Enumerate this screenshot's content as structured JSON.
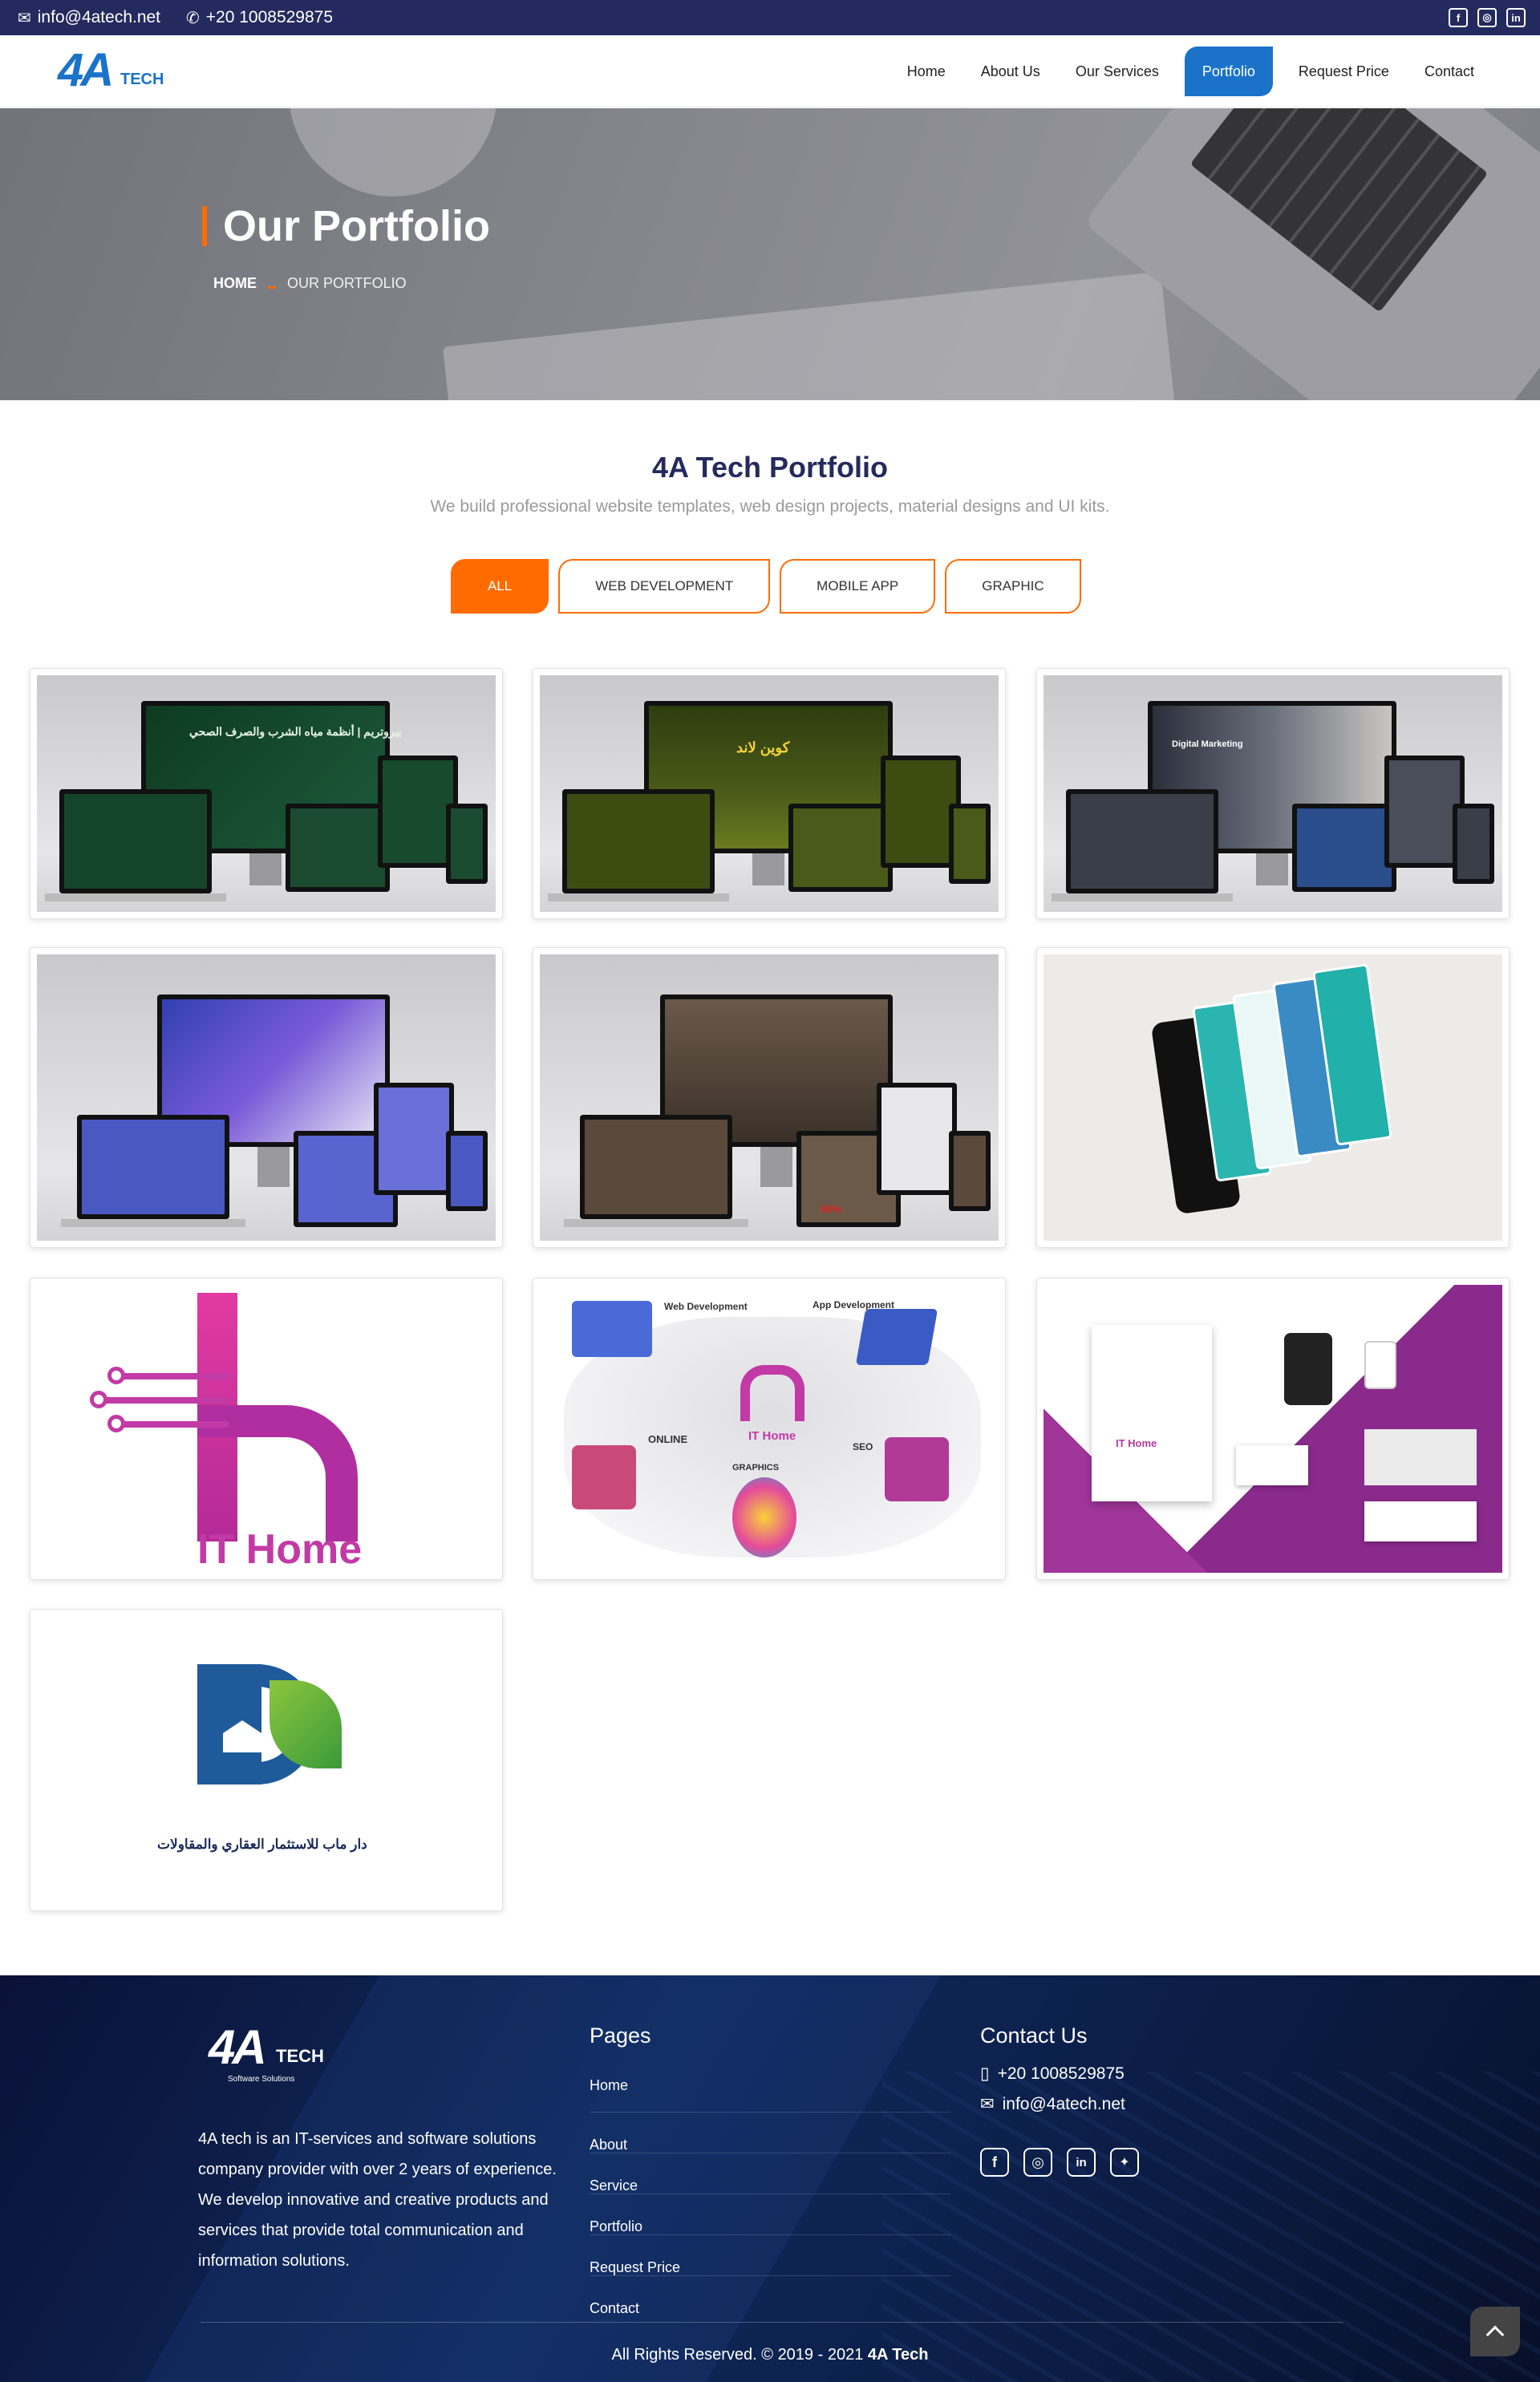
{
  "topbar": {
    "email": "info@4atech.net",
    "phone": "+20 1008529875",
    "social_icons": [
      "facebook-icon",
      "instagram-icon",
      "linkedin-icon"
    ]
  },
  "header": {
    "logo_text": "4A",
    "logo_sub": "TECH",
    "nav": [
      "Home",
      "About Us",
      "Our Services",
      "Portfolio",
      "Request Price",
      "Contact"
    ],
    "active_nav": "Portfolio"
  },
  "hero": {
    "title": "Our Portfolio",
    "breadcrumb_home": "HOME",
    "breadcrumb_current": "OUR PORTFOLIO"
  },
  "portfolio": {
    "title": "4A Tech Portfolio",
    "subtitle": "We build professional website templates, web design projects, material designs and UI kits.",
    "filters": [
      "ALL",
      "WEB DEVELOPMENT",
      "MOBILE APP",
      "GRAPHIC"
    ],
    "active_filter": "ALL",
    "items": [
      {
        "screen_text": "بيروتريم | أنظمة مياه الشرب والصرف الصحي"
      },
      {
        "screen_text": "كوين لاند"
      },
      {
        "screen_text": "Digital Marketing"
      },
      {
        "screen_text": ""
      },
      {
        "screen_text": "50%"
      },
      {
        "screen_text": ""
      },
      {
        "screen_text": "IT Home"
      },
      {
        "screen_text": "IT Home",
        "labels": [
          "Web Development",
          "App Development",
          "ONLINE",
          "SEO",
          "GRAPHICS"
        ]
      },
      {
        "screen_text": "IT Home"
      },
      {
        "screen_text": "دار ماب للاستثمار العقاري والمقاولات"
      }
    ]
  },
  "footer": {
    "logo_text": "4A",
    "logo_sub": "TECH",
    "logo_tagline": "Software Solutions",
    "about": "4A tech is an IT-services and software solutions company provider with over 2 years of experience. We develop innovative and creative products and services that provide total communication and information solutions.",
    "pages_title": "Pages",
    "pages": [
      "Home",
      "About",
      "Service",
      "Portfolio",
      "Request Price",
      "Contact"
    ],
    "contact_title": "Contact Us",
    "phone": "+20 1008529875",
    "email": "info@4atech.net",
    "social_icons": [
      "facebook-icon",
      "instagram-icon",
      "linkedin-icon",
      "twitter-icon"
    ],
    "copyright": "All Rights Reserved. © 2019 - 2021",
    "copyright_brand": "4A Tech"
  },
  "colors": {
    "navy": "#252a5e",
    "brand_blue": "#1a73c9",
    "accent_orange": "#ff6b00",
    "purple": "#b43a9c"
  }
}
